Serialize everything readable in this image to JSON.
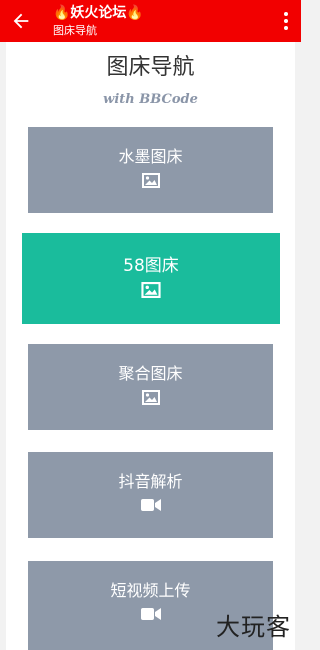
{
  "appbar": {
    "title": "🔥妖火论坛🔥",
    "subtitle": "图床导航",
    "back_icon": "arrow-left-icon",
    "menu_icon": "more-vertical-icon",
    "background": "#f20000"
  },
  "page": {
    "heading": "图床导航",
    "subheading": "with BBCode"
  },
  "cards": [
    {
      "label": "水墨图床",
      "icon": "image-icon",
      "active": false
    },
    {
      "label": "58图床",
      "icon": "image-icon",
      "active": true
    },
    {
      "label": "聚合图床",
      "icon": "image-icon",
      "active": false
    },
    {
      "label": "抖音解析",
      "icon": "video-camera-icon",
      "active": false
    },
    {
      "label": "短视频上传",
      "icon": "video-camera-icon",
      "active": false
    }
  ],
  "colors": {
    "card_default": "#8e99a9",
    "card_active": "#1abc9c"
  },
  "watermark": "大玩客"
}
